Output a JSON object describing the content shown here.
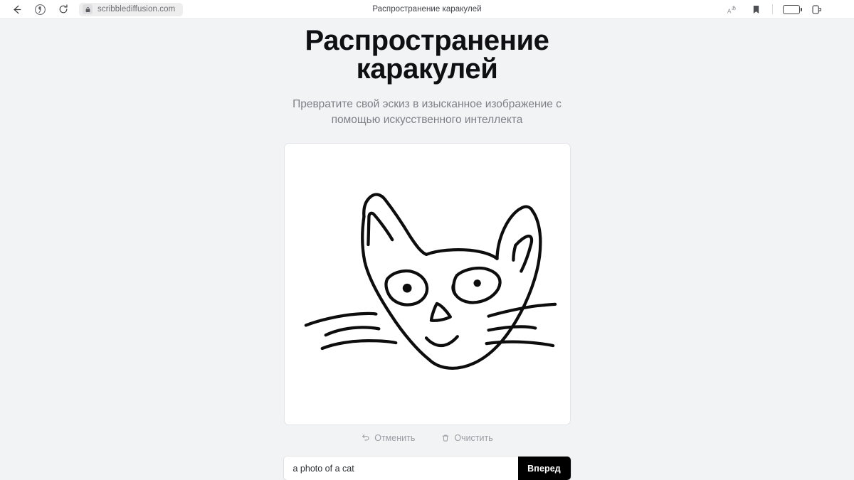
{
  "browser": {
    "tab_title": "Распространение каракулей",
    "url": "scribblediffusion.com",
    "back_icon": "back-arrow-icon",
    "home_icon": "yandex-logo-icon",
    "reload_icon": "reload-icon",
    "lock_icon": "lock-icon",
    "translate_icon": "translate-icon",
    "bookmark_icon": "bookmark-icon",
    "battery_icon": "battery-icon",
    "profile_icon": "key-tab-icon"
  },
  "page": {
    "headline": "Распространение каракулей",
    "subtitle": "Превратите свой эскиз в изысканное изображение с помощью искусственного интеллекта"
  },
  "canvas": {
    "name": "scribble-canvas",
    "background": "#ffffff",
    "stroke_color": "#0d0d0d",
    "drawing": "cat-face-sketch"
  },
  "tools": {
    "undo_label": "Отменить",
    "undo_icon": "undo-arrow-icon",
    "clear_label": "Очистить",
    "clear_icon": "trash-icon"
  },
  "prompt": {
    "value": "a photo of a cat",
    "placeholder": "a photo of a cat",
    "submit_label": "Вперед",
    "submit_bg": "#000000"
  },
  "colors": {
    "page_bg": "#f2f3f5",
    "chrome_bg": "#ffffff",
    "text_primary": "#101014",
    "text_muted": "#7c7f86",
    "battery_fill": "#f5a623"
  }
}
